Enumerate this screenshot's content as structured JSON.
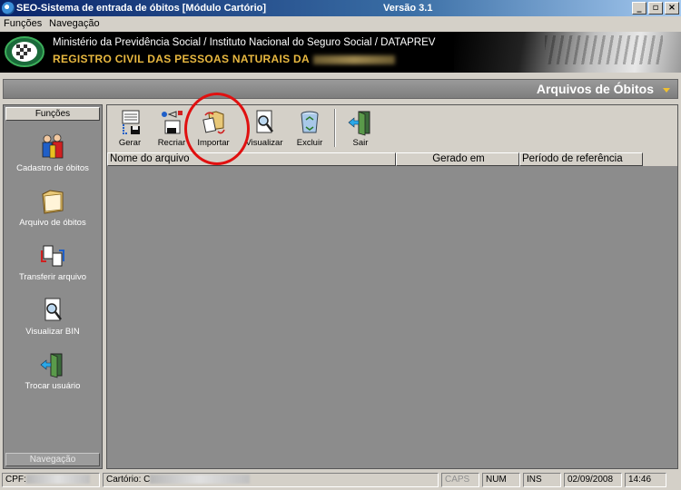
{
  "window": {
    "title": "SEO-Sistema de entrada de óbitos [Módulo Cartório]",
    "version": "Versão 3.1",
    "minimize_label": "_",
    "maximize_label": "▫",
    "close_label": "×"
  },
  "menu": {
    "items": [
      {
        "label": "Funções"
      },
      {
        "label": "Navegação"
      }
    ]
  },
  "banner": {
    "line1": "Ministério da Previdência Social / Instituto Nacional do Seguro Social / DATAPREV",
    "line2": "REGISTRO CIVIL DAS PESSOAS NATURAIS DA"
  },
  "section": {
    "title": "Arquivos de Óbitos"
  },
  "sidebar": {
    "header": "Funções",
    "footer": "Navegação",
    "items": [
      {
        "label": "Cadastro de óbitos",
        "icon": "people-icon"
      },
      {
        "label": "Arquivo de óbitos",
        "icon": "folder-icon"
      },
      {
        "label": "Transferir arquivo",
        "icon": "transfer-icon"
      },
      {
        "label": "Visualizar BIN",
        "icon": "magnify-document-icon"
      },
      {
        "label": "Trocar usuário",
        "icon": "exit-door-icon"
      }
    ]
  },
  "toolbar": {
    "buttons": [
      {
        "label": "Gerar",
        "icon": "generate-icon"
      },
      {
        "label": "Recriar",
        "icon": "recreate-icon"
      },
      {
        "label": "Importar",
        "icon": "import-icon"
      },
      {
        "label": "Visualizar",
        "icon": "view-icon"
      },
      {
        "label": "Excluir",
        "icon": "recycle-bin-icon"
      },
      {
        "label": "Sair",
        "icon": "exit-door-icon"
      }
    ]
  },
  "grid": {
    "columns": [
      {
        "label": "Nome do arquivo"
      },
      {
        "label": "Gerado em"
      },
      {
        "label": "Período de referência"
      }
    ]
  },
  "status": {
    "cpf_label": "CPF:",
    "cartorio_label": "Cartório: C",
    "caps": "CAPS",
    "num": "NUM",
    "ins": "INS",
    "date": "02/09/2008",
    "time": "14:46"
  },
  "colors": {
    "title_bar": "#0a246a",
    "banner_text": "#e8b840",
    "panel_gray": "#8c8c8c",
    "highlight": "#e01010"
  }
}
